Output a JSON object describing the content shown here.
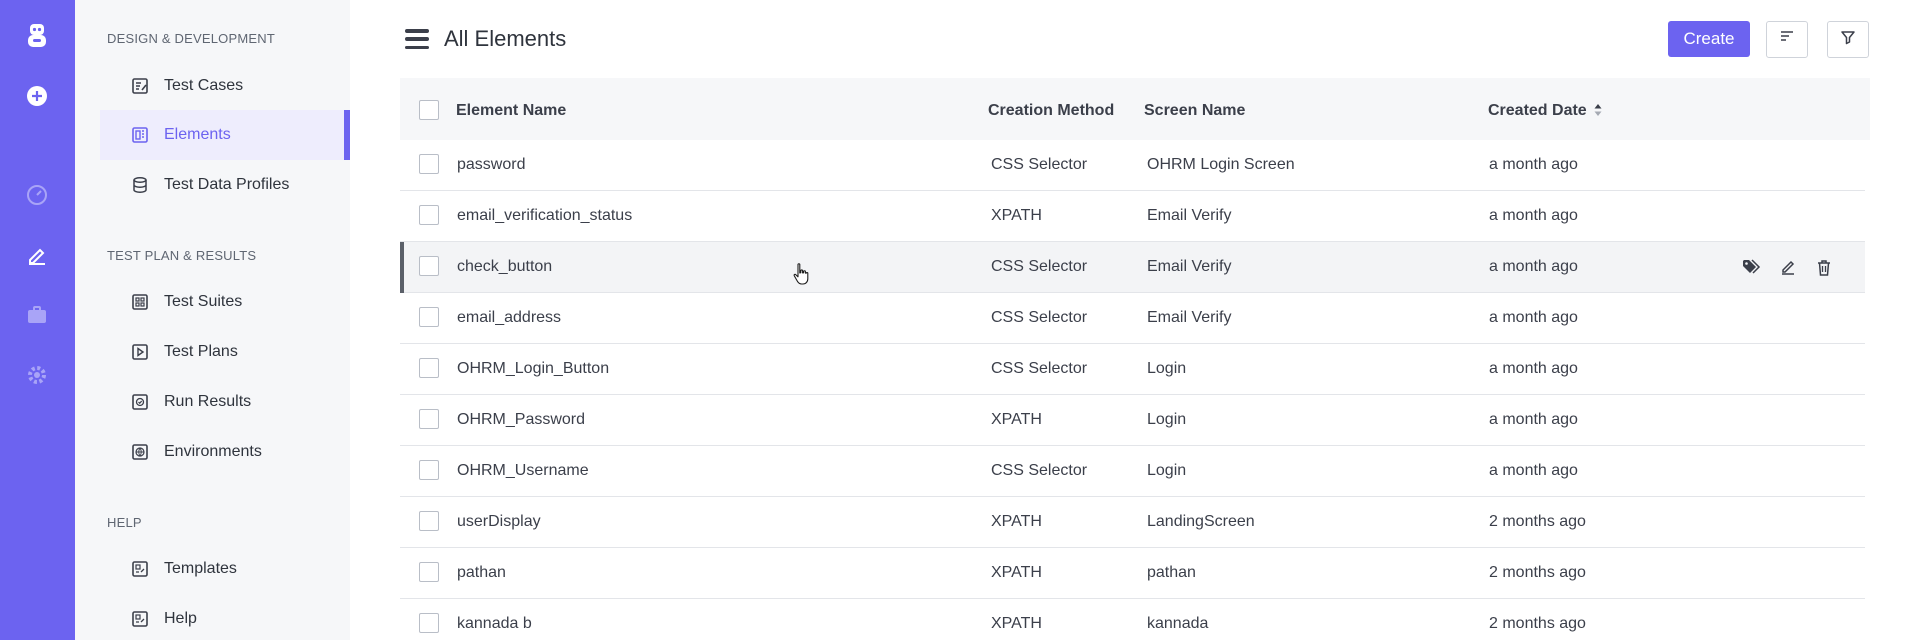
{
  "sidebar": {
    "sections": [
      {
        "title": "DESIGN & DEVELOPMENT",
        "items": [
          {
            "label": "Test Cases",
            "icon": "test-cases-icon"
          },
          {
            "label": "Elements",
            "icon": "elements-icon",
            "active": true
          },
          {
            "label": "Test Data Profiles",
            "icon": "database-icon"
          }
        ]
      },
      {
        "title": "TEST PLAN & RESULTS",
        "items": [
          {
            "label": "Test Suites",
            "icon": "test-suites-icon"
          },
          {
            "label": "Test Plans",
            "icon": "test-plans-icon"
          },
          {
            "label": "Run Results",
            "icon": "run-results-icon"
          },
          {
            "label": "Environments",
            "icon": "globe-icon"
          }
        ]
      },
      {
        "title": "HELP",
        "items": [
          {
            "label": "Templates",
            "icon": "templates-icon"
          },
          {
            "label": "Help",
            "icon": "help-icon"
          }
        ]
      }
    ]
  },
  "header": {
    "title": "All Elements",
    "create_label": "Create"
  },
  "table": {
    "columns": [
      "Element Name",
      "Creation Method",
      "Screen Name",
      "Created Date"
    ],
    "rows": [
      {
        "name": "password",
        "method": "CSS Selector",
        "screen": "OHRM Login Screen",
        "date": "a month ago"
      },
      {
        "name": "email_verification_status",
        "method": "XPATH",
        "screen": "Email Verify",
        "date": "a month ago"
      },
      {
        "name": "check_button",
        "method": "CSS Selector",
        "screen": "Email Verify",
        "date": "a month ago"
      },
      {
        "name": "email_address",
        "method": "CSS Selector",
        "screen": "Email Verify",
        "date": "a month ago"
      },
      {
        "name": "OHRM_Login_Button",
        "method": "CSS Selector",
        "screen": "Login",
        "date": "a month ago"
      },
      {
        "name": "OHRM_Password",
        "method": "XPATH",
        "screen": "Login",
        "date": "a month ago"
      },
      {
        "name": "OHRM_Username",
        "method": "CSS Selector",
        "screen": "Login",
        "date": "a month ago"
      },
      {
        "name": "userDisplay",
        "method": "XPATH",
        "screen": "LandingScreen",
        "date": "2 months ago"
      },
      {
        "name": "pathan",
        "method": "XPATH",
        "screen": "pathan",
        "date": "2 months ago"
      },
      {
        "name": "kannada b",
        "method": "XPATH",
        "screen": "kannada",
        "date": "2 months ago"
      }
    ]
  },
  "colors": {
    "accent": "#6c63f0",
    "nav_bg": "#f6f7f9",
    "text": "#3b3f4a"
  }
}
